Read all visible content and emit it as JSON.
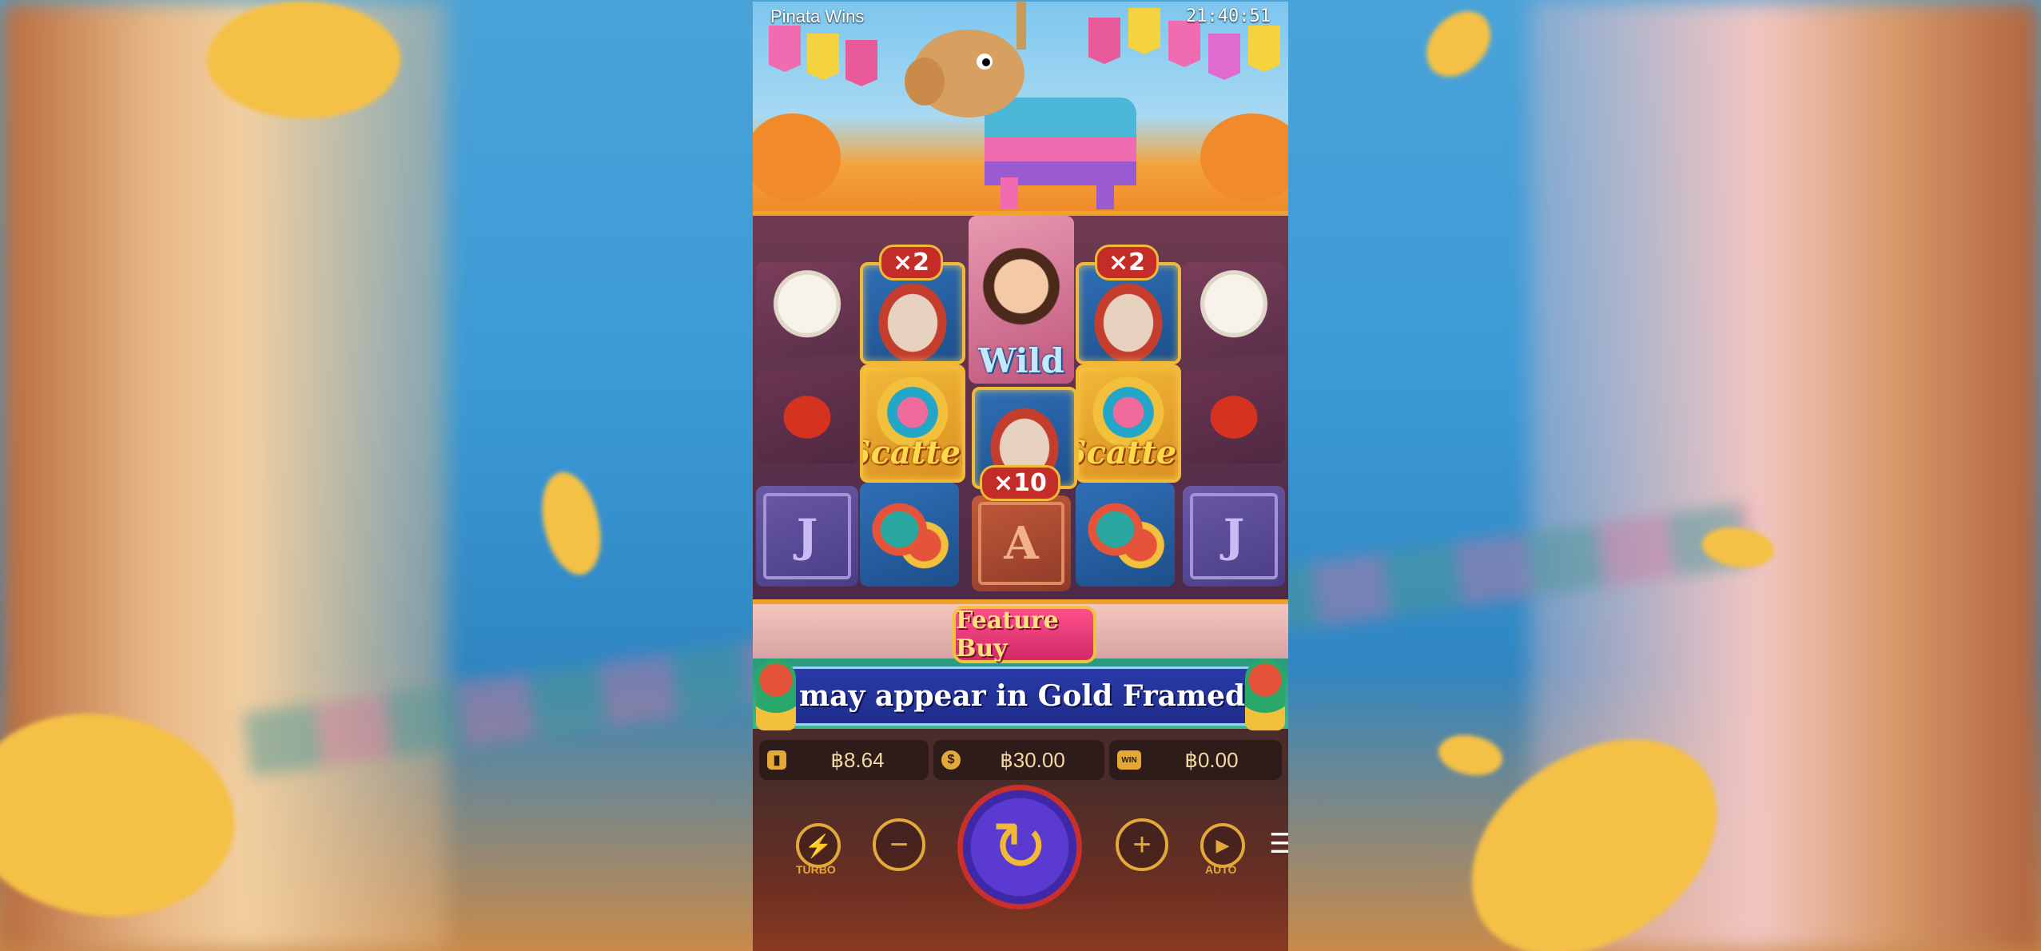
{
  "header": {
    "title": "Pinata Wins",
    "time": "21:40:51"
  },
  "reels": {
    "col1": [
      "skull",
      "chili",
      "J"
    ],
    "col2": {
      "top": "hat",
      "top_multiplier": "×2",
      "mid": "Scatter",
      "bottom": "maracas"
    },
    "col3": {
      "top": "Wild",
      "mid": "hat",
      "mid_multiplier": "×10",
      "bottom": "A"
    },
    "col4": {
      "top": "hat",
      "top_multiplier": "×2",
      "mid": "Scatter",
      "bottom": "maracas"
    },
    "col5": [
      "skull",
      "chili",
      "J"
    ],
    "scatter_label": "Scatter",
    "wild_label": "Wild",
    "j_label": "J",
    "a_label": "A"
  },
  "feature_buy": {
    "label": "Feature Buy"
  },
  "banner": {
    "text": "may appear in Gold Framed symbols!"
  },
  "stats": {
    "balance": "฿8.64",
    "bet": "฿30.00",
    "win_icon": "WIN",
    "win": "฿0.00"
  },
  "controls": {
    "turbo_label": "TURBO",
    "auto_label": "AUTO",
    "minus_glyph": "−",
    "plus_glyph": "+",
    "turbo_glyph": "⚡",
    "auto_glyph": "▶",
    "spin_glyph": "↻",
    "menu_glyph": "☰"
  },
  "colors": {
    "accent_gold": "#e3a838",
    "spin_purple": "#5a3ad0",
    "feature_pink": "#ff4f8a"
  },
  "icons": [
    "wallet-icon",
    "coin-icon",
    "win-icon",
    "turbo-icon",
    "minus-icon",
    "spin-icon",
    "plus-icon",
    "auto-play-icon",
    "menu-icon"
  ]
}
